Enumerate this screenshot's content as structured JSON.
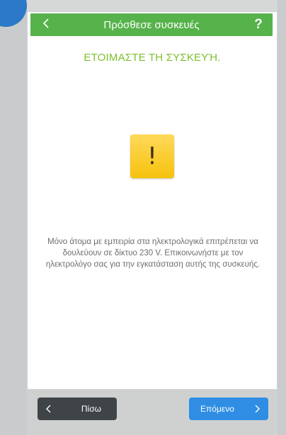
{
  "header": {
    "title": "Πρόσθεσε συσκευές",
    "help_label": "?"
  },
  "step": {
    "title": "ΕΤΟΙΜΑΣΤΕ ΤΗ ΣΥΣΚΕΥΉ."
  },
  "warning": {
    "icon_symbol": "!",
    "text": "Μόνο άτομα με εμπειρία στα ηλεκτρολογικά επιτρέπεται να δουλεύουν σε δίκτυο 230 V. Επικοινωνήστε με τον ηλεκτρολόγο σας για την εγκατάσταση αυτής της συσκευής."
  },
  "footer": {
    "back_label": "Πίσω",
    "next_label": "Επόμενο"
  },
  "icons": {
    "header_back": "chevron-left-icon",
    "help": "question-mark-icon",
    "warning": "warning-icon",
    "footer_back": "chevron-left-icon",
    "footer_next": "chevron-right-icon"
  },
  "colors": {
    "header_green": "#56b24a",
    "title_green": "#7dbf2e",
    "warning_yellow": "#f6c20d",
    "back_button": "#3f4447",
    "next_button": "#2f8ee4"
  }
}
